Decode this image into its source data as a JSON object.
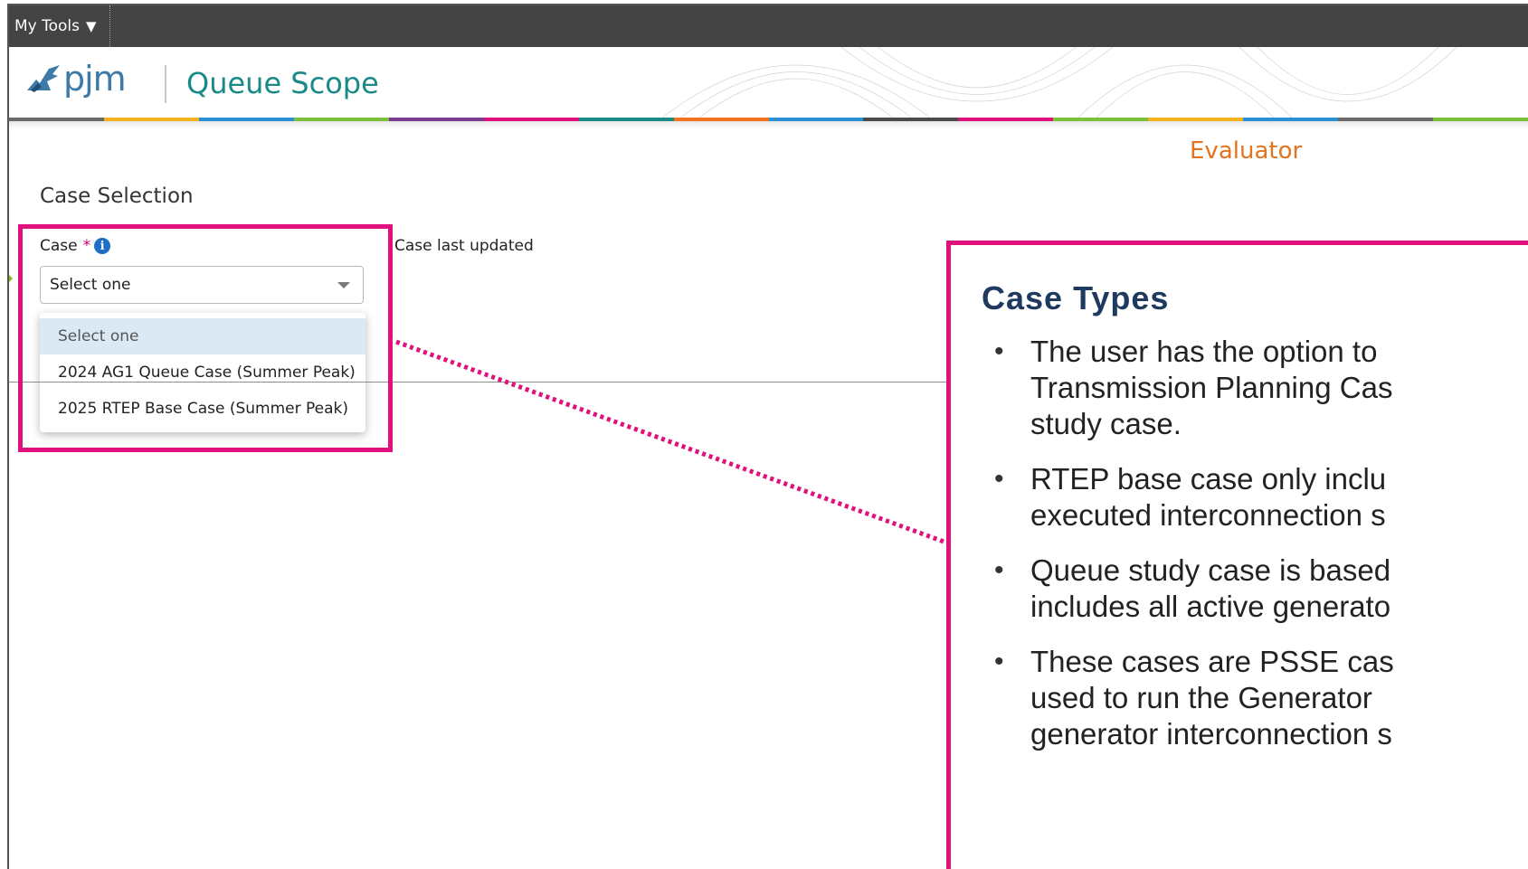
{
  "topbar": {
    "my_tools_label": "My Tools",
    "my_tools_caret": "▼"
  },
  "header": {
    "logo_text": "pjm",
    "logo_registered": "·",
    "app_title": "Queue Scope",
    "stripe_colors": [
      "#6a6a6a",
      "#f2b21d",
      "#2c8fd1",
      "#7cbf3d",
      "#7a3c91",
      "#e0107c",
      "#1a8a87",
      "#f2741f",
      "#2c8fd1",
      "#4a4a4a",
      "#e0107c",
      "#7cbf3d",
      "#f2b21d",
      "#2c8fd1",
      "#6a6a6a",
      "#7cbf3d"
    ]
  },
  "page": {
    "role_label": "Evaluator",
    "section_title": "Case Selection",
    "case_label": "Case",
    "required_marker": "*",
    "info_icon": "i",
    "case_last_updated_label": "Case last updated",
    "case_select": {
      "value": "Select one",
      "options": [
        "Select one",
        "2024 AG1 Queue Case (Summer Peak)",
        "2025 RTEP Base Case (Summer Peak)"
      ]
    }
  },
  "callout": {
    "title": "Case Types",
    "bullet_glyph": "•",
    "bullets": [
      [
        "The user has the option to",
        "Transmission Planning Cas",
        "study case."
      ],
      [
        "RTEP base case only inclu",
        "executed interconnection s"
      ],
      [
        "Queue study case is based",
        "includes all active generato"
      ],
      [
        "These cases are PSSE cas",
        "used to run the Generator",
        "generator interconnection s"
      ]
    ]
  },
  "colors": {
    "highlight": "#e0107c",
    "title_teal": "#1a8a87",
    "evaluator_orange": "#e2731f",
    "callout_title": "#1f3a5f",
    "arrow_green": "#7dbb2a"
  }
}
